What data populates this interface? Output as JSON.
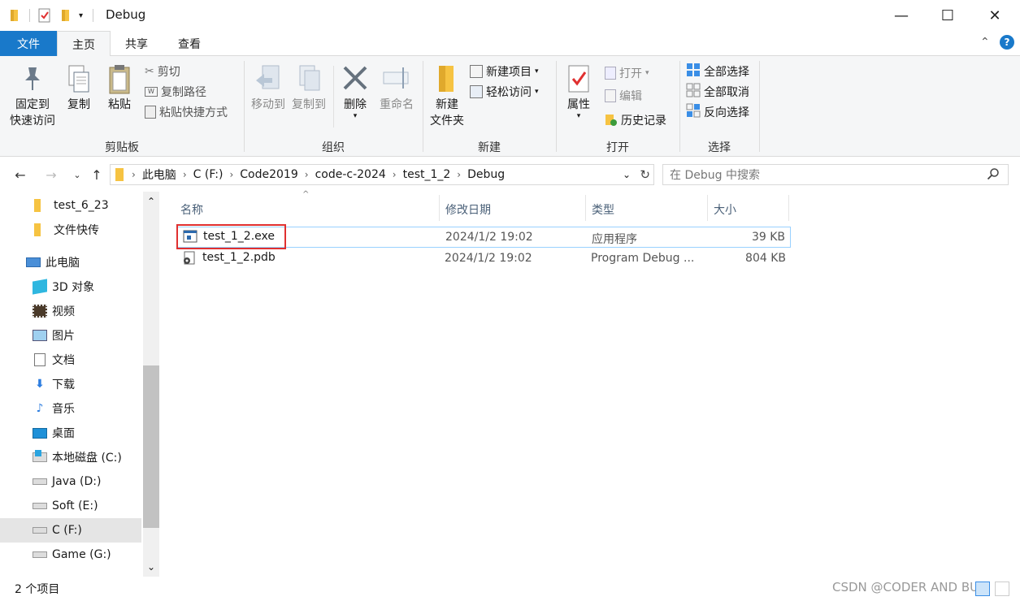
{
  "window": {
    "title": "Debug",
    "minimize": "—",
    "maximize": "☐",
    "close": "✕"
  },
  "tabs": {
    "file": "文件",
    "home": "主页",
    "share": "共享",
    "view": "查看"
  },
  "ribbon": {
    "clipboard": {
      "label": "剪贴板",
      "pin_line1": "固定到",
      "pin_line2": "快速访问",
      "copy": "复制",
      "paste": "粘贴",
      "cut": "剪切",
      "copy_path": "复制路径",
      "paste_shortcut": "粘贴快捷方式"
    },
    "organize": {
      "label": "组织",
      "move_to": "移动到",
      "copy_to": "复制到",
      "delete": "删除",
      "rename": "重命名"
    },
    "new": {
      "label": "新建",
      "new_folder_line1": "新建",
      "new_folder_line2": "文件夹",
      "new_item": "新建项目",
      "easy_access": "轻松访问"
    },
    "open": {
      "label": "打开",
      "properties": "属性",
      "open": "打开",
      "edit": "编辑",
      "history": "历史记录"
    },
    "select": {
      "label": "选择",
      "select_all": "全部选择",
      "select_none": "全部取消",
      "invert": "反向选择"
    }
  },
  "address": {
    "crumbs": [
      "此电脑",
      "C (F:)",
      "Code2019",
      "code-c-2024",
      "test_1_2",
      "Debug"
    ],
    "search_placeholder": "在 Debug 中搜索"
  },
  "sidebar": {
    "items": [
      {
        "label": "test_6_23",
        "icon": "folder-icon"
      },
      {
        "label": "文件快传",
        "icon": "folder-icon"
      },
      {
        "label": "此电脑",
        "icon": "computer-icon"
      },
      {
        "label": "3D 对象",
        "icon": "cube-icon"
      },
      {
        "label": "视频",
        "icon": "video-icon"
      },
      {
        "label": "图片",
        "icon": "picture-icon"
      },
      {
        "label": "文档",
        "icon": "document-icon"
      },
      {
        "label": "下载",
        "icon": "download-icon"
      },
      {
        "label": "音乐",
        "icon": "music-icon"
      },
      {
        "label": "桌面",
        "icon": "desktop-icon"
      },
      {
        "label": "本地磁盘 (C:)",
        "icon": "windows-drive-icon"
      },
      {
        "label": "Java (D:)",
        "icon": "drive-icon"
      },
      {
        "label": "Soft (E:)",
        "icon": "drive-icon"
      },
      {
        "label": "C (F:)",
        "icon": "drive-icon"
      },
      {
        "label": "Game (G:)",
        "icon": "drive-icon"
      }
    ]
  },
  "file_list": {
    "columns": [
      "名称",
      "修改日期",
      "类型",
      "大小"
    ],
    "rows": [
      {
        "name": "test_1_2.exe",
        "date": "2024/1/2 19:02",
        "type": "应用程序",
        "size": "39 KB",
        "icon": "exe-icon"
      },
      {
        "name": "test_1_2.pdb",
        "date": "2024/1/2 19:02",
        "type": "Program Debug ...",
        "size": "804 KB",
        "icon": "pdb-icon"
      }
    ]
  },
  "status": {
    "count": "2 个项目",
    "watermark": "CSDN @CODER AND BUG"
  },
  "colors": {
    "accent": "#1979ca",
    "highlight": "#e03030",
    "selection_border": "#99d1ff"
  }
}
